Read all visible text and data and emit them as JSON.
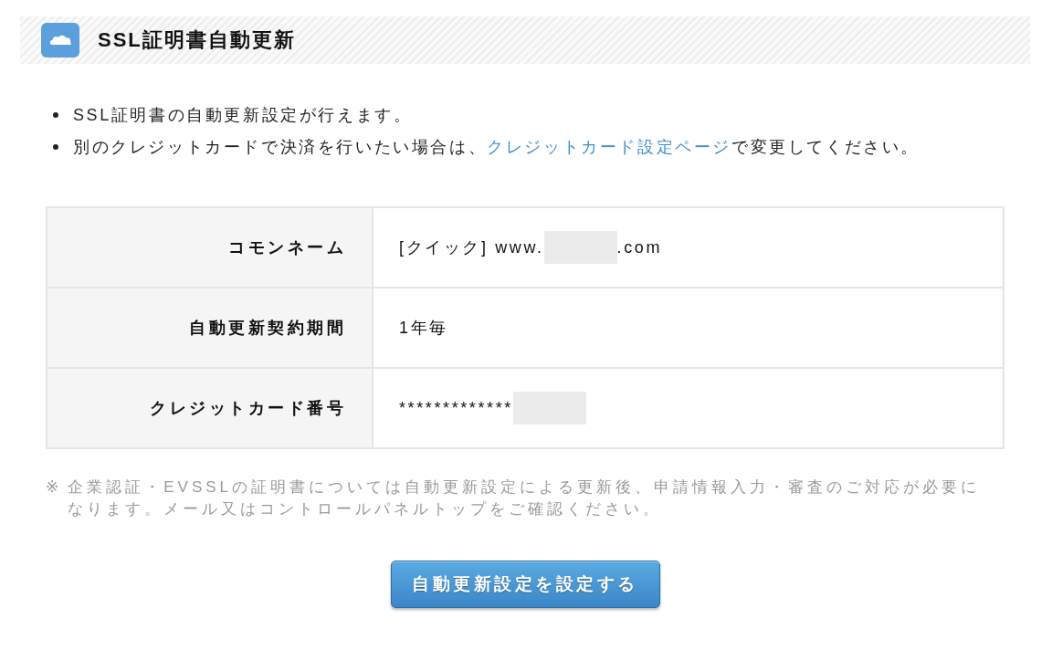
{
  "header": {
    "title": "SSL証明書自動更新"
  },
  "bullets": [
    {
      "segments": [
        {
          "kind": "text",
          "text": "SSL証明書の自動更新設定が行えます。"
        }
      ]
    },
    {
      "segments": [
        {
          "kind": "text",
          "text": "別のクレジットカードで決済を行いたい場合は、"
        },
        {
          "kind": "link",
          "text": "クレジットカード設定ページ"
        },
        {
          "kind": "text",
          "text": "で変更してください。"
        }
      ]
    }
  ],
  "table": {
    "rows": [
      {
        "label": "コモンネーム",
        "value": [
          {
            "kind": "text",
            "text": "[クイック] www."
          },
          {
            "kind": "redacted"
          },
          {
            "kind": "text",
            "text": ".com"
          }
        ]
      },
      {
        "label": "自動更新契約期間",
        "value": [
          {
            "kind": "text",
            "text": "1年毎"
          }
        ]
      },
      {
        "label": "クレジットカード番号",
        "value": [
          {
            "kind": "text",
            "text": "*************"
          },
          {
            "kind": "redacted"
          }
        ]
      }
    ]
  },
  "note": {
    "mark": "※",
    "text": "企業認証・EVSSLの証明書については自動更新設定による更新後、申請情報入力・審査のご対応が必要になります。メール又はコントロールパネルトップをご確認ください。"
  },
  "submit_button": {
    "label": "自動更新設定を設定する"
  }
}
